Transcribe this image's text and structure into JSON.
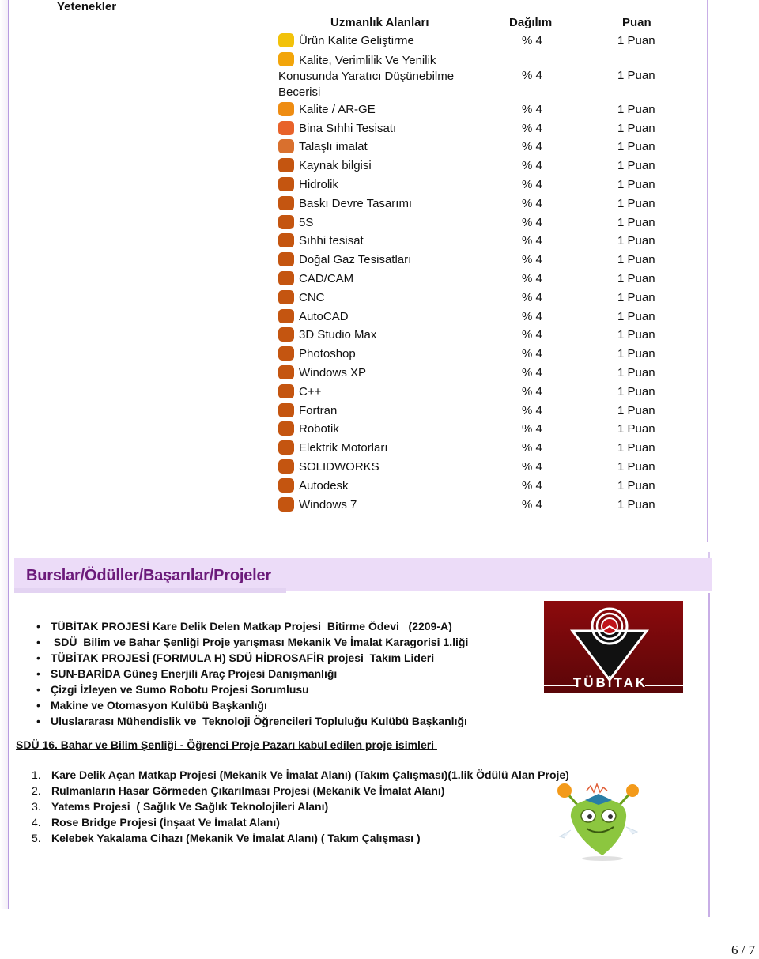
{
  "skills": {
    "section_title": "Yetenekler",
    "headers": {
      "area": "Uzmanlık Alanları",
      "distribution": "Dağılım",
      "score": "Puan"
    },
    "items": [
      {
        "label": "Ürün Kalite Geliştirme",
        "distribution": "% 4",
        "score": "1 Puan",
        "color": "#f2c20a"
      },
      {
        "label": "Kalite, Verimlilik Ve Yenilik Konusunda Yaratıcı Düşünebilme Becerisi",
        "distribution": "% 4",
        "score": "1 Puan",
        "color": "#f2a50a"
      },
      {
        "label": "Kalite / AR-GE",
        "distribution": "% 4",
        "score": "1 Puan",
        "color": "#ee8c12"
      },
      {
        "label": "Bina Sıhhi Tesisatı",
        "distribution": "% 4",
        "score": "1 Puan",
        "color": "#e8622a"
      },
      {
        "label": "Talaşlı imalat",
        "distribution": "% 4",
        "score": "1 Puan",
        "color": "#d9702e"
      },
      {
        "label": "Kaynak bilgisi",
        "distribution": "% 4",
        "score": "1 Puan",
        "color": "#c45510"
      },
      {
        "label": "Hidrolik",
        "distribution": "% 4",
        "score": "1 Puan",
        "color": "#c45510"
      },
      {
        "label": "Baskı Devre Tasarımı",
        "distribution": "% 4",
        "score": "1 Puan",
        "color": "#c45510"
      },
      {
        "label": "5S",
        "distribution": "% 4",
        "score": "1 Puan",
        "color": "#c45510"
      },
      {
        "label": "Sıhhi tesisat",
        "distribution": "% 4",
        "score": "1 Puan",
        "color": "#c45510"
      },
      {
        "label": "Doğal Gaz Tesisatları",
        "distribution": "% 4",
        "score": "1 Puan",
        "color": "#c45510"
      },
      {
        "label": "CAD/CAM",
        "distribution": "% 4",
        "score": "1 Puan",
        "color": "#c45510"
      },
      {
        "label": "CNC",
        "distribution": "% 4",
        "score": "1 Puan",
        "color": "#c45510"
      },
      {
        "label": "AutoCAD",
        "distribution": "% 4",
        "score": "1 Puan",
        "color": "#c45510"
      },
      {
        "label": "3D Studio Max",
        "distribution": "% 4",
        "score": "1 Puan",
        "color": "#c45510"
      },
      {
        "label": "Photoshop",
        "distribution": "% 4",
        "score": "1 Puan",
        "color": "#c45510"
      },
      {
        "label": "Windows XP",
        "distribution": "% 4",
        "score": "1 Puan",
        "color": "#c45510"
      },
      {
        "label": "C++",
        "distribution": "% 4",
        "score": "1 Puan",
        "color": "#c45510"
      },
      {
        "label": "Fortran",
        "distribution": "% 4",
        "score": "1 Puan",
        "color": "#c45510"
      },
      {
        "label": "Robotik",
        "distribution": "% 4",
        "score": "1 Puan",
        "color": "#c45510"
      },
      {
        "label": "Elektrik Motorları",
        "distribution": "% 4",
        "score": "1 Puan",
        "color": "#c45510"
      },
      {
        "label": "SOLIDWORKS",
        "distribution": "% 4",
        "score": "1 Puan",
        "color": "#c45510"
      },
      {
        "label": "Autodesk",
        "distribution": "% 4",
        "score": "1 Puan",
        "color": "#c45510"
      },
      {
        "label": "Windows 7",
        "distribution": "% 4",
        "score": "1 Puan",
        "color": "#c45510"
      }
    ]
  },
  "awards": {
    "section_title": "Burslar/Ödüller/Başarılar/Projeler",
    "title_color": "#6b1a7a",
    "banner_color": "#ecdcf8",
    "bullet": "•",
    "items": [
      "TÜBİTAK PROJESİ Kare Delik Delen Matkap Projesi  Bitirme Ödevi   (2209-A)",
      " SDÜ  Bilim ve Bahar Şenliği Proje yarışması Mekanik Ve İmalat Karagorisi 1.liği",
      "TÜBİTAK PROJESİ (FORMULA H) SDÜ HİDROSAFİR projesi  Takım Lideri",
      "SUN-BARİDA Güneş Enerjili Araç Projesi Danışmanlığı",
      "Çizgi İzleyen ve Sumo Robotu Projesi Sorumlusu",
      "Makine ve Otomasyon Kulübü Başkanlığı",
      "Uluslararası Mühendislik ve  Teknoloji Öğrencileri Topluluğu Kulübü Başkanlığı"
    ],
    "logo": {
      "icon": "tubitak-logo-icon",
      "text": "TÜBİTAK"
    }
  },
  "projects": {
    "title": "SDÜ 16. Bahar ve Bilim Şenliği - Öğrenci Proje Pazarı kabul edilen proje isimleri ",
    "items": [
      {
        "num": "1.",
        "text": "Kare Delik Açan Matkap Projesi (Mekanik Ve İmalat Alanı) (Takım Çalışması)(1.lik Ödülü Alan Proje)"
      },
      {
        "num": "2.",
        "text": "Rulmanların Hasar Görmeden Çıkarılması Projesi (Mekanik Ve İmalat Alanı)"
      },
      {
        "num": "3.",
        "text": "Yatems Projesi  ( Sağlık Ve Sağlık Teknolojileri Alanı)"
      },
      {
        "num": "4.",
        "text": "Rose Bridge Projesi (İnşaat Ve İmalat Alanı)"
      },
      {
        "num": "5.",
        "text": "Kelebek Yakalama Cihazı (Mekanik Ve İmalat Alanı) ( Takım Çalışması )"
      }
    ],
    "mascot_icon": "mascot-graduate-icon"
  },
  "page": {
    "number": "6 / 7"
  }
}
